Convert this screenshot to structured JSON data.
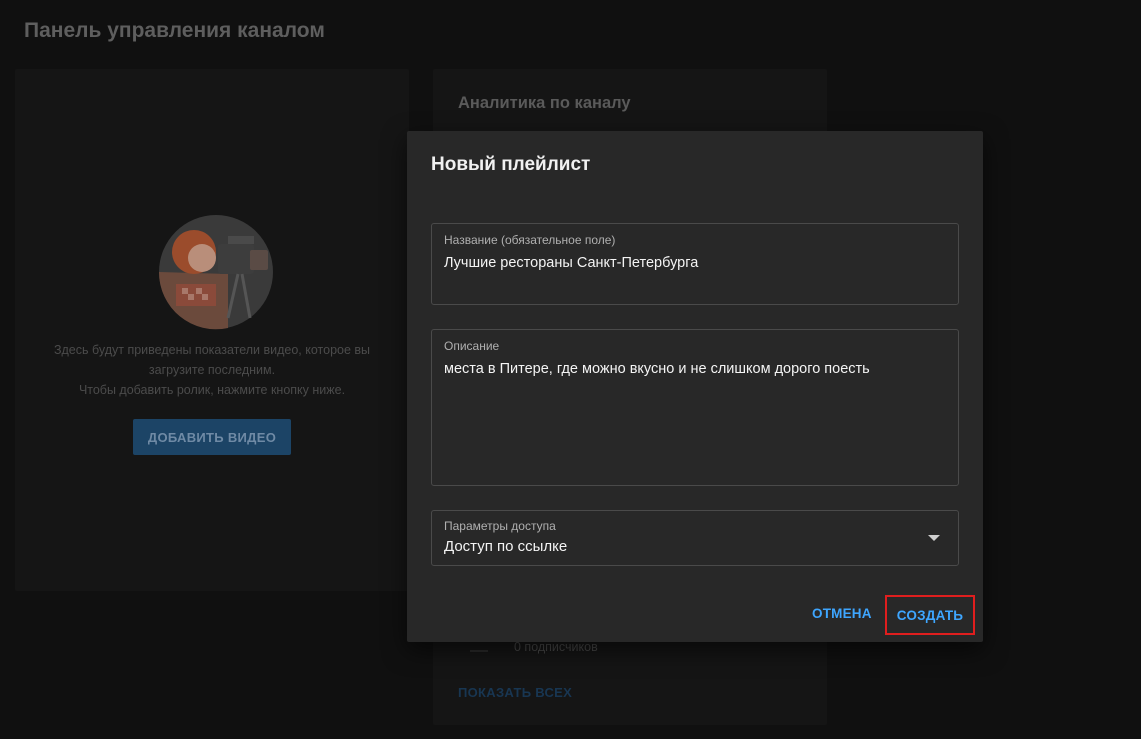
{
  "page": {
    "title": "Панель управления каналом"
  },
  "upload_card": {
    "line1": "Здесь будут приведены показатели видео, которое вы",
    "line2": "загрузите последним.",
    "line3": "Чтобы добавить ролик, нажмите кнопку ниже.",
    "button": "ДОБАВИТЬ ВИДЕО"
  },
  "analytics_card": {
    "title": "Аналитика по каналу",
    "subscribers": "0 подписчиков",
    "show_all": "ПОКАЗАТЬ ВСЕХ"
  },
  "dialog": {
    "title": "Новый плейлист",
    "name_field": {
      "label": "Название (обязательное поле)",
      "value": "Лучшие рестораны Санкт-Петербурга"
    },
    "description_field": {
      "label": "Описание",
      "value": "места в Питере, где можно вкусно и не слишком дорого поесть"
    },
    "access_field": {
      "label": "Параметры доступа",
      "value": "Доступ по ссылке"
    },
    "cancel": "ОТМЕНА",
    "create": "СОЗДАТЬ"
  },
  "colors": {
    "accent": "#3ea6ff",
    "highlight": "#e01e1e",
    "dialog_bg": "#282828"
  }
}
